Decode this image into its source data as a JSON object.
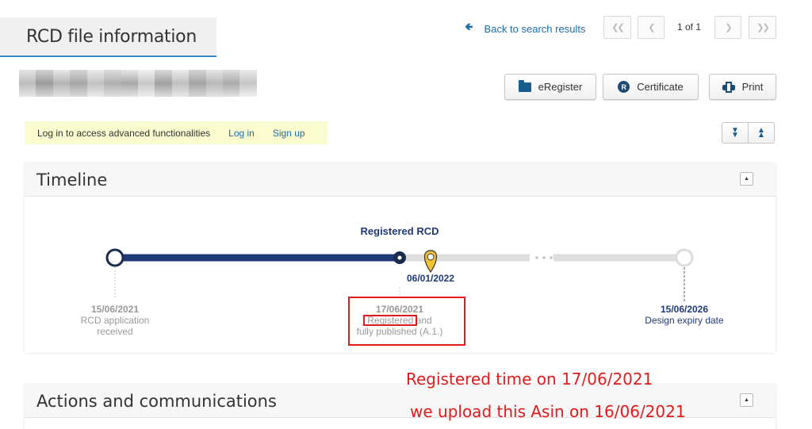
{
  "header": {
    "title": "RCD file information",
    "back_link": "Back to search results",
    "pagination": {
      "first": "«",
      "prev": "‹",
      "text": "1 of 1",
      "next": "›",
      "last": "»"
    }
  },
  "actions": {
    "eregister": "eRegister",
    "certificate": "Certificate",
    "certificate_icon_letter": "R",
    "print": "Print"
  },
  "login_bar": {
    "message": "Log in to access advanced functionalities",
    "login": "Log in",
    "signup": "Sign up"
  },
  "timeline": {
    "title": "Timeline",
    "highlight_label": "Registered RCD",
    "current_date": "06/01/2022",
    "events": [
      {
        "date": "15/06/2021",
        "line1": "RCD application",
        "line2": "received"
      },
      {
        "date": "17/06/2021",
        "line1": "Registered and",
        "line2": "fully published (A.1.)"
      },
      {
        "date": "15/06/2026",
        "line1": "Design expiry date",
        "line2": ""
      }
    ]
  },
  "actions_panel": {
    "title": "Actions and communications"
  },
  "annotations": {
    "line1": "Registered time on 17/06/2021",
    "line2": "we upload this Asin on 16/06/2021"
  },
  "colors": {
    "primary_dark": "#1f3a7a",
    "link": "#1d6ea8",
    "marker_yellow": "#f1c232",
    "annotation_red": "#e21a1a",
    "info_bar": "#fbfbd0"
  }
}
